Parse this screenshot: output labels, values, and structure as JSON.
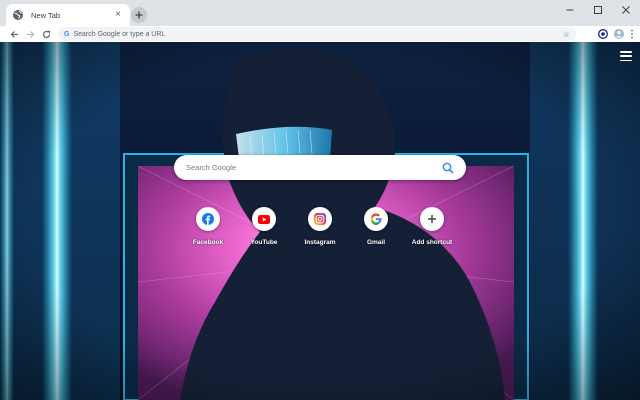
{
  "tab": {
    "title": "New Tab",
    "close_glyph": "×",
    "favicon": "globe-icon"
  },
  "window_controls": {
    "minimize": "–",
    "maximize": "☐",
    "close": "✕"
  },
  "toolbar": {
    "omnibox_placeholder": "Search Google or type a URL"
  },
  "search": {
    "placeholder": "Search Google"
  },
  "shortcuts": [
    {
      "label": "Facebook",
      "icon": "facebook-icon",
      "color": "#1877f2"
    },
    {
      "label": "YouTube",
      "icon": "youtube-icon",
      "color": "#ff0000"
    },
    {
      "label": "Instagram",
      "icon": "instagram-icon",
      "color": "#c13584"
    },
    {
      "label": "Gmail",
      "icon": "google-icon",
      "color": "#4285f4"
    },
    {
      "label": "Add shortcut",
      "icon": "plus-icon",
      "color": "#3c4043"
    }
  ],
  "colors": {
    "tabstrip": "#dee1e6",
    "accent_cyan": "#27d3ff",
    "accent_pink": "#ff5ad8"
  }
}
